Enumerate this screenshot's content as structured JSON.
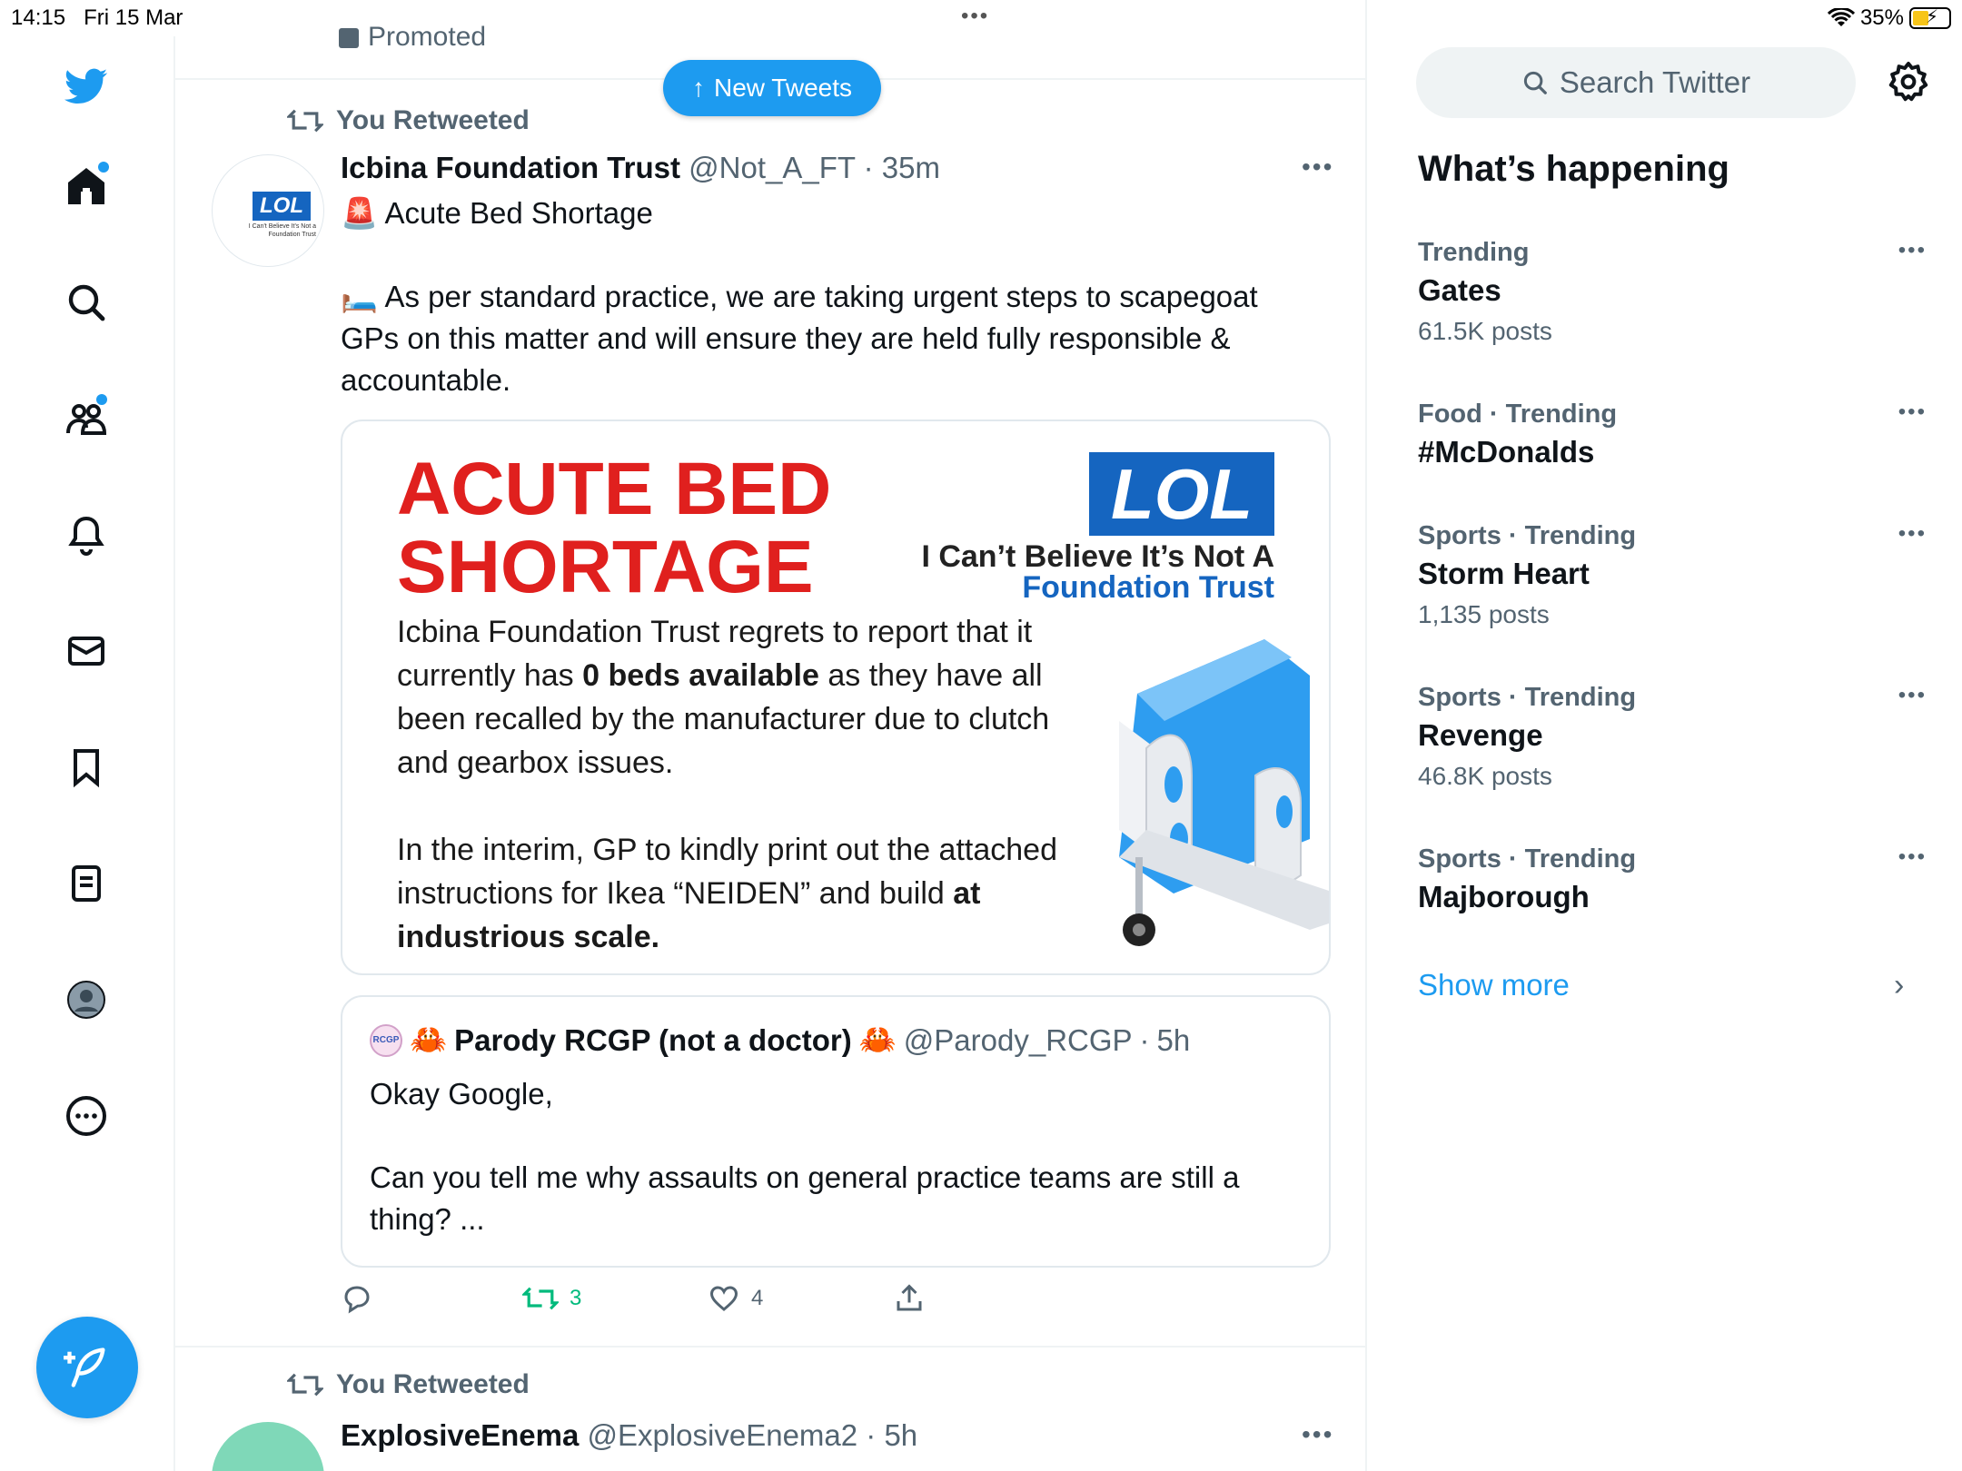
{
  "status": {
    "time": "14:15",
    "date": "Fri 15 Mar",
    "battery": "35%"
  },
  "feed": {
    "promoted_label": "Promoted",
    "new_tweets_label": "New Tweets",
    "tweet1": {
      "retweet_label": "You Retweeted",
      "name": "Icbina Foundation Trust",
      "handle": "@Not_A_FT",
      "time": "35m",
      "line1": "Acute Bed Shortage",
      "line2": "As per standard practice, we are taking urgent steps to scapegoat GPs on this matter and will ensure they are held fully responsible & accountable.",
      "avatar_text": "LOL",
      "avatar_sub": "I Can't Believe It's Not a Foundation Trust",
      "media": {
        "title1": "ACUTE BED",
        "title2": "SHORTAGE",
        "logo": "LOL",
        "logo_sub1": "I Can’t Believe It’s Not A",
        "logo_sub2": "Foundation Trust",
        "p1_a": "Icbina Foundation Trust regrets to report that it currently has ",
        "p1_bold": "0 beds available",
        "p1_b": " as they have all been recalled by the manufacturer due to clutch and gearbox issues.",
        "p2_a": "In the interim, GP to kindly print out the attached instructions for Ikea “NEIDEN” and build ",
        "p2_bold": "at industrious scale."
      },
      "quote": {
        "avatar_text": "RCGP",
        "name": "Parody RCGP (not a doctor)",
        "handle": "@Parody_RCGP",
        "time": "5h",
        "line1": "Okay Google,",
        "line2": "Can you tell me why assaults on general practice teams are still a thing? ..."
      },
      "retweets": "3",
      "likes": "4"
    },
    "tweet2": {
      "retweet_label": "You Retweeted",
      "name": "ExplosiveEnema",
      "handle": "@ExplosiveEnema2",
      "time": "5h"
    }
  },
  "sidebar": {
    "search_placeholder": "Search Twitter",
    "title": "What’s happening",
    "trends": [
      {
        "category": "Trending",
        "name": "Gates",
        "count": "61.5K posts"
      },
      {
        "category": "Food · Trending",
        "name": "#McDonalds",
        "count": ""
      },
      {
        "category": "Sports · Trending",
        "name": "Storm Heart",
        "count": "1,135 posts"
      },
      {
        "category": "Sports · Trending",
        "name": "Revenge",
        "count": "46.8K posts"
      },
      {
        "category": "Sports · Trending",
        "name": "Majborough",
        "count": ""
      }
    ],
    "show_more": "Show more"
  },
  "colors": {
    "accent": "#1d9bf0",
    "retweet_green": "#00ba7c",
    "alert_red": "#e0201e",
    "lol_blue": "#1565c0"
  }
}
